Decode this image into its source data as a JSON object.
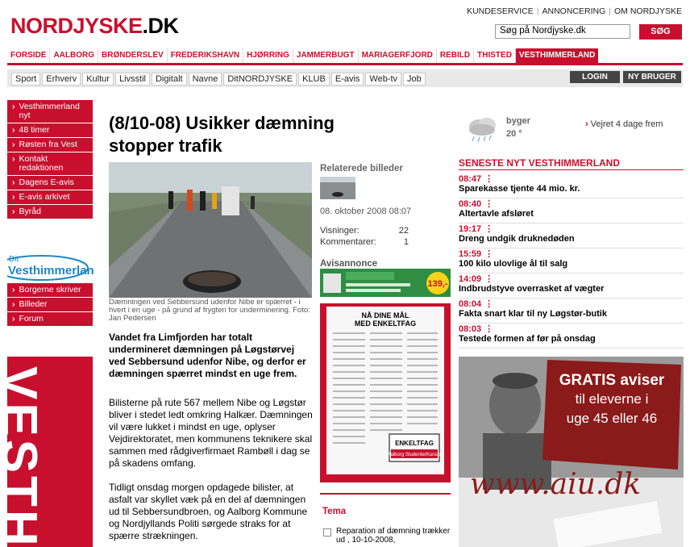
{
  "header": {
    "logo_part1": "NORDJYSKE",
    "logo_part2": ".DK",
    "top_links": [
      "KUNDESERVICE",
      "ANNONCERING",
      "OM NORDJYSKE"
    ],
    "search_value": "Søg på Nordjyske.dk",
    "search_button": "SØG"
  },
  "nav_regions": [
    "FORSIDE",
    "AALBORG",
    "BRØNDERSLEV",
    "FREDERIKSHAVN",
    "HJØRRING",
    "JAMMERBUGT",
    "MARIAGERFJORD",
    "REBILD",
    "THISTED",
    "VESTHIMMERLAND"
  ],
  "nav_sections": [
    "Sport",
    "Erhverv",
    "Kultur",
    "Livsstil",
    "Digitalt",
    "Navne",
    "DitNORDJYSKE",
    "KLUB",
    "E-avis",
    "Web-tv",
    "Job"
  ],
  "auth": {
    "login": "LOGIN",
    "register": "NY BRUGER"
  },
  "sidebar": {
    "items": [
      "Vesthimmerland nyt",
      "48 timer",
      "Røsten fra Vest",
      "Kontakt redaktionen",
      "Dagens E-avis",
      "E-avis arkivet",
      "Byråd"
    ],
    "dit_logo_small": "Dit",
    "dit_logo_big": "Vesthimmerland",
    "items2": [
      "Borgerne skriver",
      "Billeder",
      "Forum"
    ],
    "vertical_text": "VESTHI"
  },
  "article": {
    "headline": "(8/10-08) Usikker dæmning stopper trafik",
    "caption": "Dæmningen ved Sebbersund udenfor Nibe er spærret - i hvert i en uge - på grund af frygten for underminering. Foto: Jan Pedersen",
    "lead": "Vandet fra Limfjorden har totalt undermineret dæmningen på Løgstørvej ved Sebbersund udenfor Nibe, og derfor er dæmningen spærret mindst en uge frem.",
    "body1": "Bilisterne på rute 567 mellem Nibe og Løgstør bliver i stedet ledt omkring Halkær. Dæmningen vil være lukket i mindst en uge, oplyser Vejdirektoratet, men kommunens teknikere skal sammen med rådgiverfirmaet Rambøll i dag se på skadens omfang.",
    "body2": "Tidligt onsdag morgen opdagede bilister, at asfalt var skyllet væk på en del af dæmningen ud til Sebbersundbroen, og Aalborg Kommune og Nordjyllands Politi sørgede straks for at spærre strækningen."
  },
  "related": {
    "title": "Relaterede billeder",
    "date": "08. oktober 2008 08:07",
    "views_label": "Visninger:",
    "views": "22",
    "comments_label": "Kommentarer:",
    "comments": "1",
    "ad_title": "Avisannonce",
    "banner_price": "139,-",
    "ad_headline1": "NÅ DINE MÅL",
    "ad_headline2": "MED ENKELTFAG",
    "ad_box_title": "ENKELTFAG",
    "ad_box_sub": "Aalborg StudenterKursus",
    "tema_title": "Tema",
    "tema_item": "Reparation af dæmning trækker ud , 10-10-2008,"
  },
  "weather": {
    "condition": "byger",
    "temp": "20 °",
    "link": "Vejret 4 dage frem"
  },
  "news": {
    "title": "SENESTE NYT VESTHIMMERLAND",
    "items": [
      {
        "time": "08:47",
        "title": "Sparekasse tjente 44 mio. kr."
      },
      {
        "time": "08:40",
        "title": "Altertavle afsløret"
      },
      {
        "time": "19:17",
        "title": "Dreng undgik druknedøden"
      },
      {
        "time": "15:59",
        "title": "100 kilo ulovlige ål til salg"
      },
      {
        "time": "14:09",
        "title": "Indbrudstyve overrasket af vægter"
      },
      {
        "time": "08:04",
        "title": "Fakta snart klar til ny Løgstør-butik"
      },
      {
        "time": "08:03",
        "title": "Testede formen af før på onsdag"
      }
    ]
  },
  "gratis_ad": {
    "line1": "GRATIS aviser",
    "line2": "til eleverne i",
    "line3": "uge 45 eller 46",
    "url": "www.aiu.dk"
  },
  "colors": {
    "brand_red": "#c8102e",
    "nav_gray": "#e9e9e9"
  }
}
